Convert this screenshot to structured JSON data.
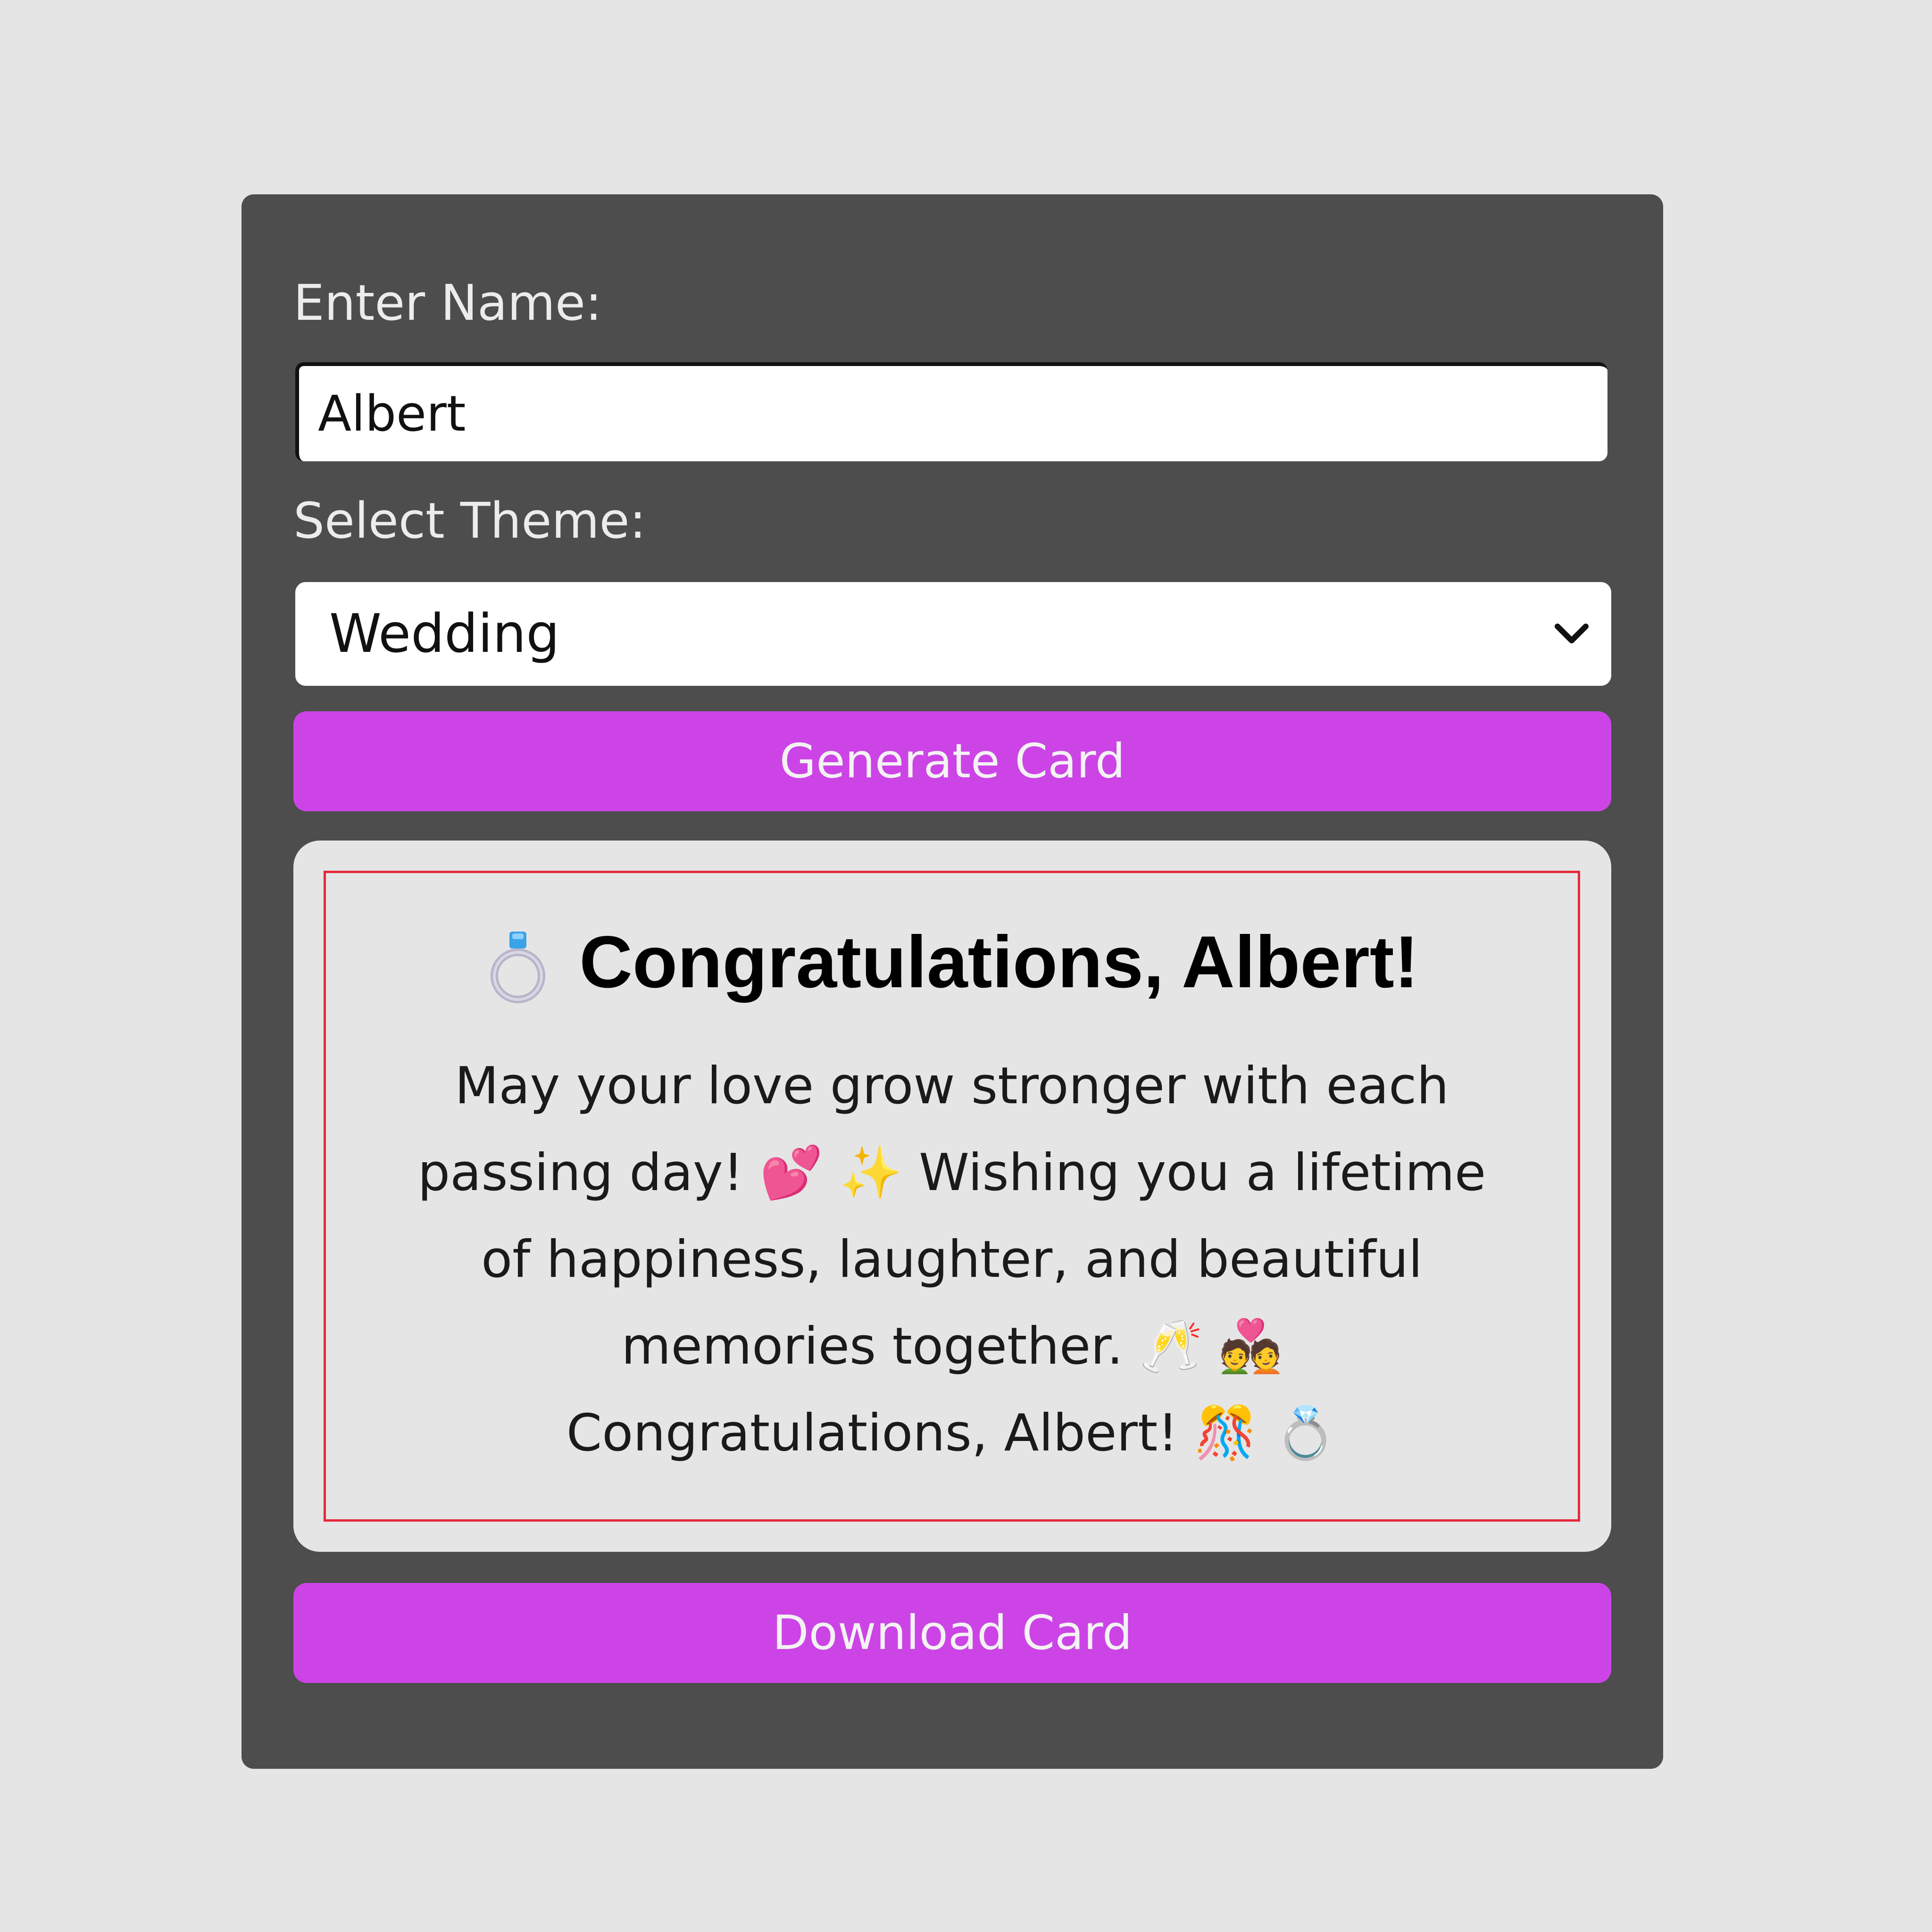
{
  "form": {
    "name_label": "Enter Name:",
    "name_value": "Albert",
    "theme_label": "Select Theme:",
    "theme_value": "Wedding",
    "generate_label": "Generate Card",
    "download_label": "Download Card"
  },
  "card": {
    "title": "Congratulations, Albert!",
    "title_icon": "ring-icon",
    "message": "May your love grow stronger with each passing day! 💕 ✨ Wishing you a lifetime of happiness, laughter, and beautiful memories together. 🥂 💑 Congratulations, Albert! 🎊 💍"
  },
  "colors": {
    "background": "#e5e5e5",
    "panel": "#4d4d4d",
    "accent": "#cc44e6",
    "card_border": "#e5293b"
  }
}
